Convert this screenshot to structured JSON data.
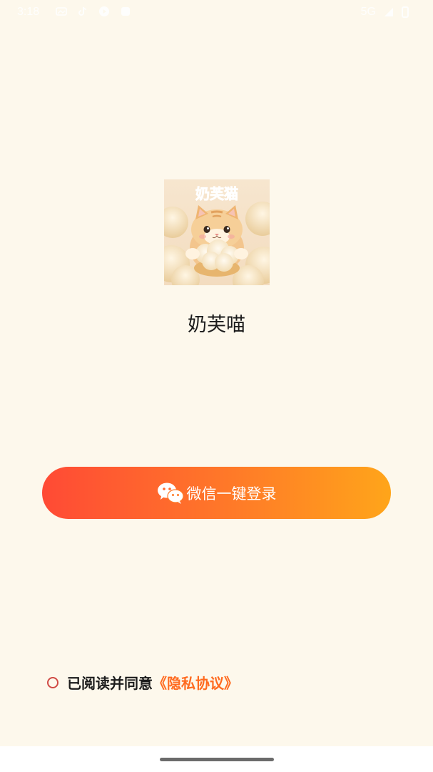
{
  "status_bar": {
    "time": "3:18",
    "network": "5G",
    "icons": [
      "gallery-icon",
      "tiktok-icon",
      "media-icon",
      "notification-icon",
      "signal-icon",
      "battery-icon"
    ]
  },
  "app": {
    "logo_text": "奶芙猫",
    "name": "奶芙喵"
  },
  "login": {
    "label": "微信一键登录",
    "icon": "wechat-icon",
    "gradient": [
      "#ff4a35",
      "#ffa51a"
    ]
  },
  "agreement": {
    "checked": false,
    "prefix": "已阅读并同意",
    "link": "《隐私协议》",
    "link_color": "#ff6a1f"
  },
  "colors": {
    "background": "#fdf8ec"
  }
}
